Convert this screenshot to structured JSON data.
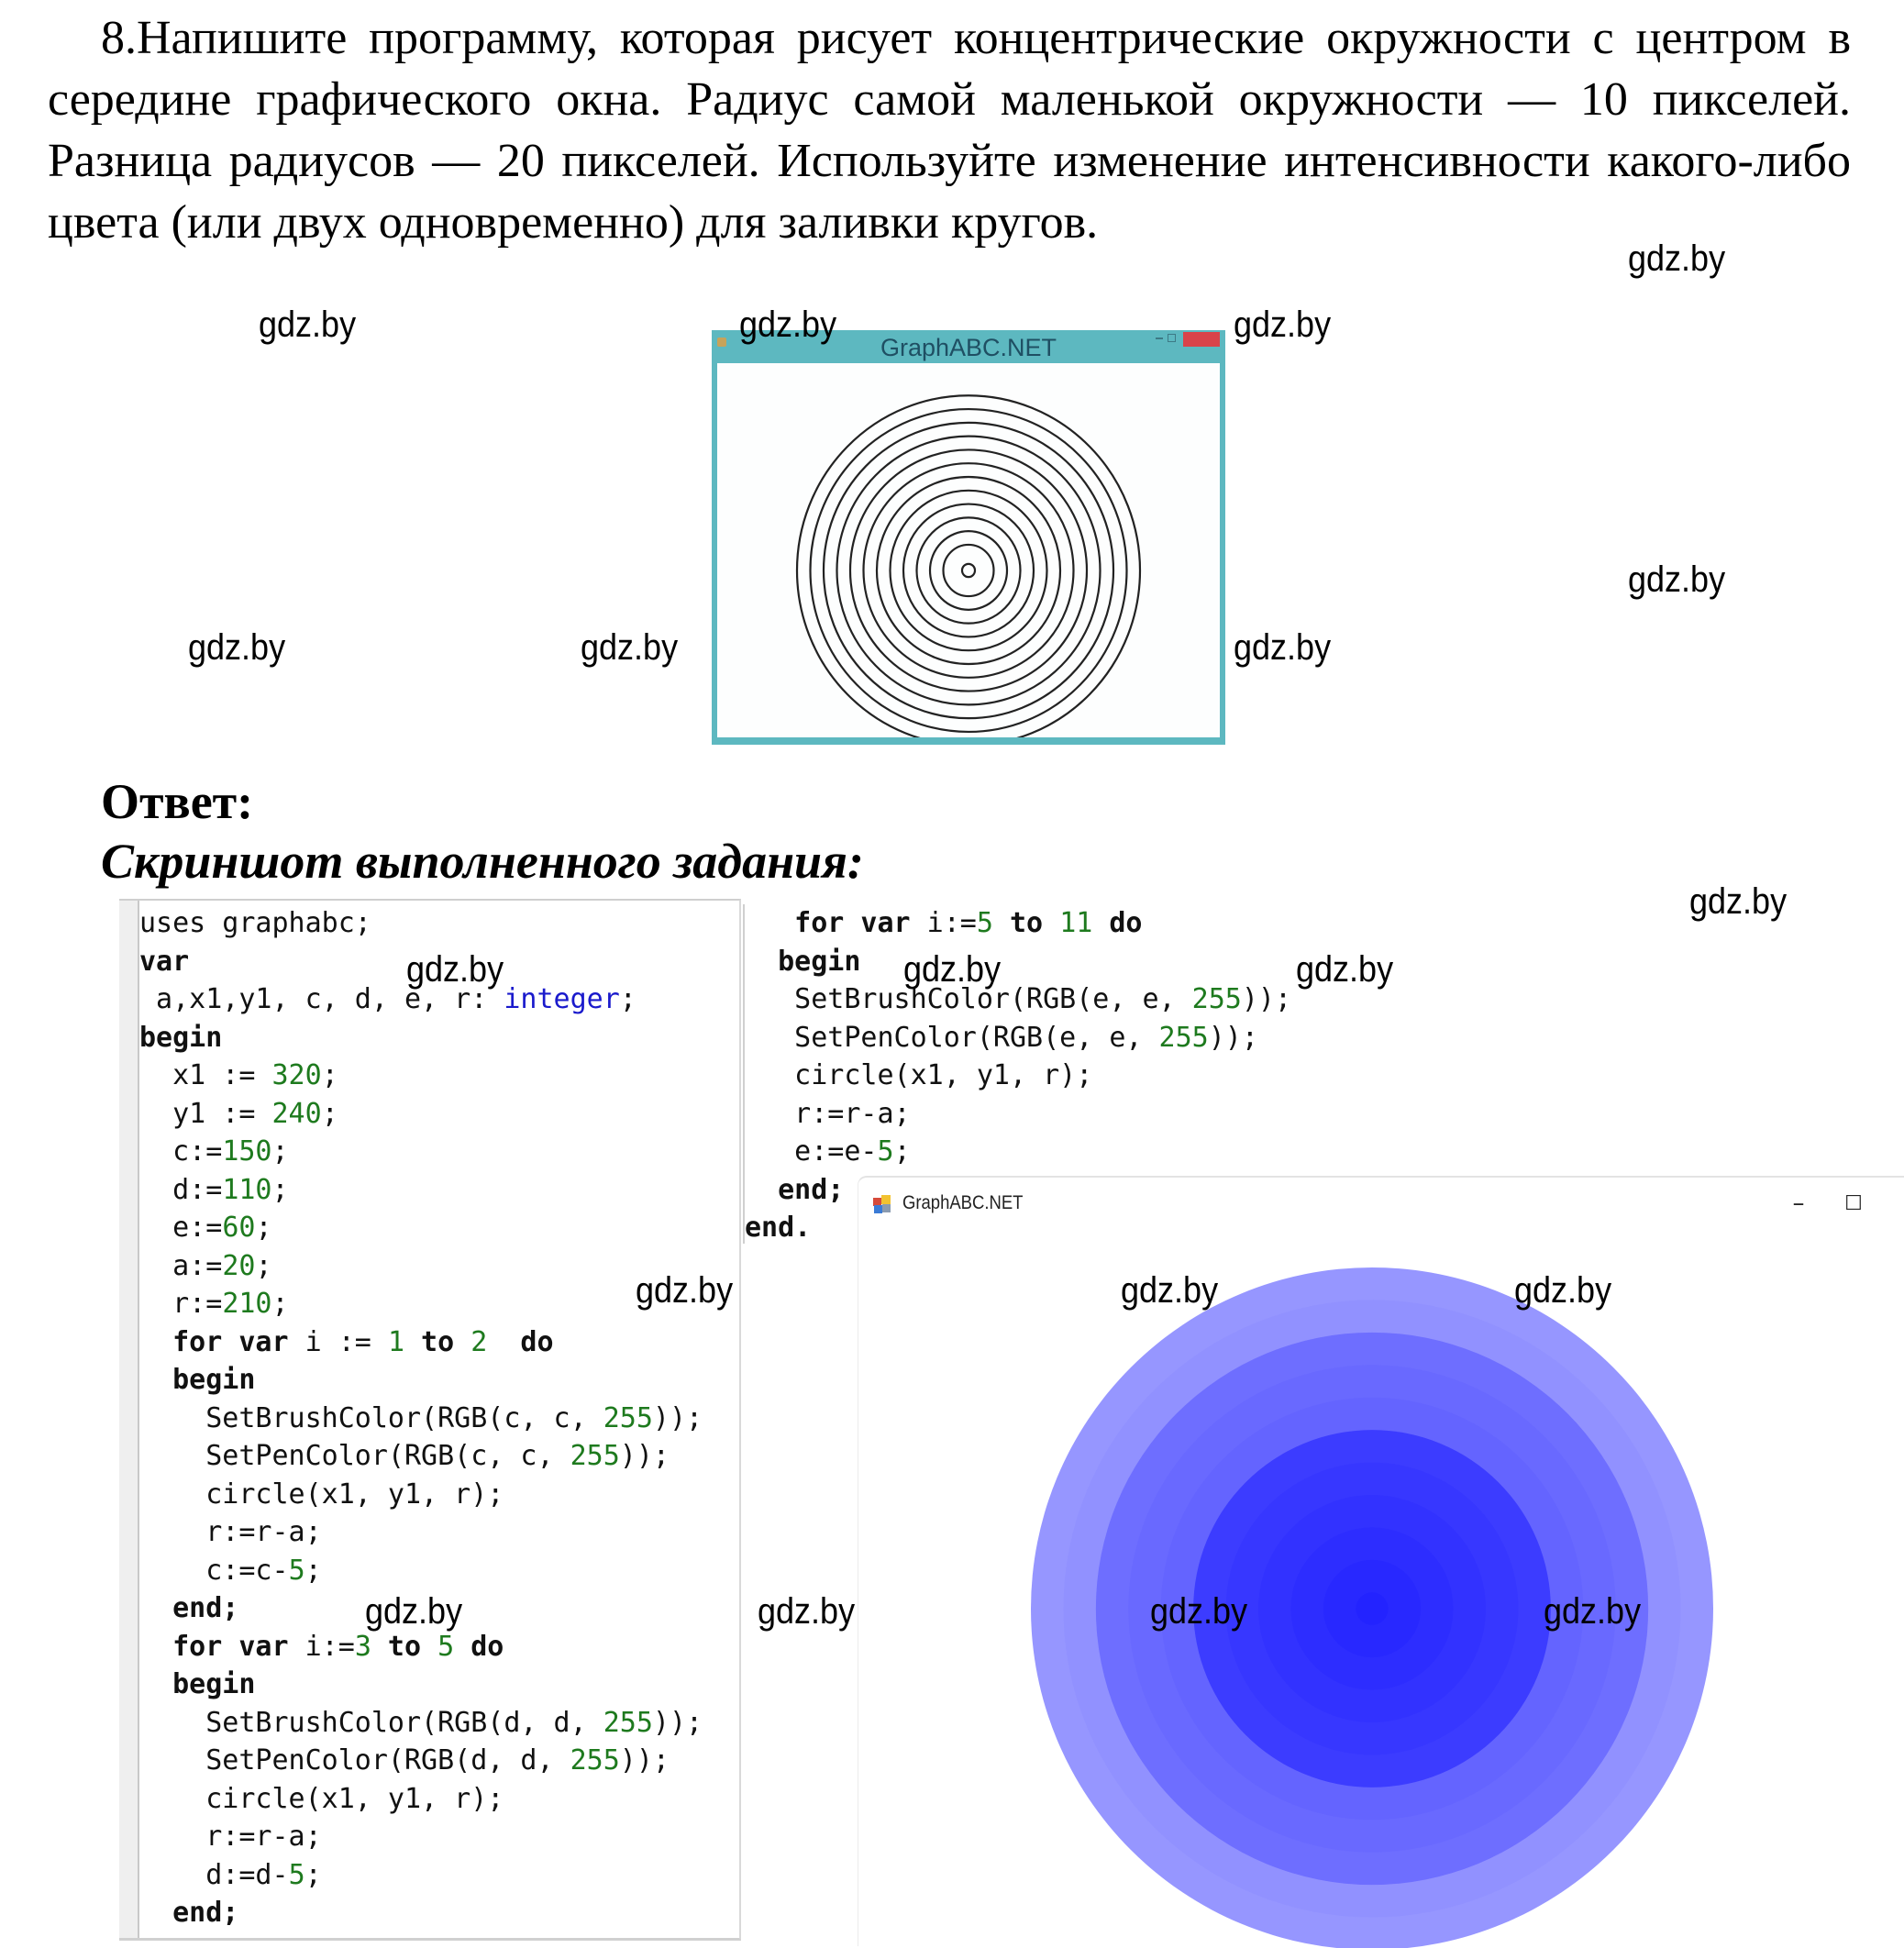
{
  "task": {
    "text": "8.Напишите программу, которая рисует концентрические окружности с центром в середине графического окна. Радиус самой маленькой окружности — 10 пикселей. Разница радиусов — 20 пикселей. Используйте изменение интенсивности какого-либо цвета (или двух одновременно) для заливки кругов."
  },
  "watermark": "gdz.by",
  "example_window": {
    "title": "GraphABC.NET",
    "ring_count": 13,
    "ring_color": "#222222",
    "frame_color": "#5db8c0"
  },
  "answer": {
    "heading": "Ответ:",
    "subtitle": "Скриншот выполненного задания:"
  },
  "code_left": [
    [
      {
        "t": "uses graphabc;",
        "c": "kw-plain"
      }
    ],
    [
      {
        "t": "var",
        "c": "kw"
      }
    ],
    [
      {
        "t": " a,x1,y1, c, d, e, r: "
      },
      {
        "t": "integer",
        "c": "type"
      },
      {
        "t": ";"
      }
    ],
    [
      {
        "t": "begin",
        "c": "kw"
      }
    ],
    [
      {
        "t": "  x1 := "
      },
      {
        "t": "320",
        "c": "num"
      },
      {
        "t": ";"
      }
    ],
    [
      {
        "t": "  y1 := "
      },
      {
        "t": "240",
        "c": "num"
      },
      {
        "t": ";"
      }
    ],
    [
      {
        "t": "  c:="
      },
      {
        "t": "150",
        "c": "num"
      },
      {
        "t": ";"
      }
    ],
    [
      {
        "t": "  d:="
      },
      {
        "t": "110",
        "c": "num"
      },
      {
        "t": ";"
      }
    ],
    [
      {
        "t": "  e:="
      },
      {
        "t": "60",
        "c": "num"
      },
      {
        "t": ";"
      }
    ],
    [
      {
        "t": "  a:="
      },
      {
        "t": "20",
        "c": "num"
      },
      {
        "t": ";"
      }
    ],
    [
      {
        "t": "  r:="
      },
      {
        "t": "210",
        "c": "num"
      },
      {
        "t": ";"
      }
    ],
    [
      {
        "t": "  for var",
        "c": "kw"
      },
      {
        "t": " i := "
      },
      {
        "t": "1",
        "c": "num"
      },
      {
        "t": " to ",
        "c": "kw"
      },
      {
        "t": "2",
        "c": "num"
      },
      {
        "t": "  do",
        "c": "kw"
      }
    ],
    [
      {
        "t": "  begin",
        "c": "kw"
      }
    ],
    [
      {
        "t": "    SetBrushColor(RGB(c, c, "
      },
      {
        "t": "255",
        "c": "num"
      },
      {
        "t": "));"
      }
    ],
    [
      {
        "t": "    SetPenColor(RGB(c, c, "
      },
      {
        "t": "255",
        "c": "num"
      },
      {
        "t": "));"
      }
    ],
    [
      {
        "t": "    circle(x1, y1, r);"
      }
    ],
    [
      {
        "t": "    r:=r-a;"
      }
    ],
    [
      {
        "t": "    c:=c-"
      },
      {
        "t": "5",
        "c": "num"
      },
      {
        "t": ";"
      }
    ],
    [
      {
        "t": "  end;",
        "c": "kw"
      }
    ],
    [
      {
        "t": "  for var",
        "c": "kw"
      },
      {
        "t": " i:="
      },
      {
        "t": "3",
        "c": "num"
      },
      {
        "t": " to ",
        "c": "kw"
      },
      {
        "t": "5",
        "c": "num"
      },
      {
        "t": " do",
        "c": "kw"
      }
    ],
    [
      {
        "t": "  begin",
        "c": "kw"
      }
    ],
    [
      {
        "t": "    SetBrushColor(RGB(d, d, "
      },
      {
        "t": "255",
        "c": "num"
      },
      {
        "t": "));"
      }
    ],
    [
      {
        "t": "    SetPenColor(RGB(d, d, "
      },
      {
        "t": "255",
        "c": "num"
      },
      {
        "t": "));"
      }
    ],
    [
      {
        "t": "    circle(x1, y1, r);"
      }
    ],
    [
      {
        "t": "    r:=r-a;"
      }
    ],
    [
      {
        "t": "    d:=d-"
      },
      {
        "t": "5",
        "c": "num"
      },
      {
        "t": ";"
      }
    ],
    [
      {
        "t": "  end;",
        "c": "kw"
      }
    ]
  ],
  "code_right": [
    [
      {
        "t": "   for var",
        "c": "kw"
      },
      {
        "t": " i:="
      },
      {
        "t": "5",
        "c": "num"
      },
      {
        "t": " to ",
        "c": "kw"
      },
      {
        "t": "11",
        "c": "num"
      },
      {
        "t": " do",
        "c": "kw"
      }
    ],
    [
      {
        "t": "  begin",
        "c": "kw"
      }
    ],
    [
      {
        "t": "   SetBrushColor(RGB(e, e, "
      },
      {
        "t": "255",
        "c": "num"
      },
      {
        "t": "));"
      }
    ],
    [
      {
        "t": "   SetPenColor(RGB(e, e, "
      },
      {
        "t": "255",
        "c": "num"
      },
      {
        "t": "));"
      }
    ],
    [
      {
        "t": "   circle(x1, y1, r);"
      }
    ],
    [
      {
        "t": "   r:=r-a;"
      }
    ],
    [
      {
        "t": "   e:=e-"
      },
      {
        "t": "5",
        "c": "num"
      },
      {
        "t": ";"
      }
    ],
    [
      {
        "t": "  end;",
        "c": "kw"
      }
    ],
    [
      {
        "t": "end.",
        "c": "kw"
      }
    ]
  ],
  "result_window": {
    "title": "GraphABC.NET",
    "minimize_label": "–",
    "maximize_label": "☐",
    "close_label": "✕",
    "circles": [
      {
        "r": 210,
        "rgb": [
          150,
          150,
          255
        ]
      },
      {
        "r": 190,
        "rgb": [
          145,
          145,
          255
        ]
      },
      {
        "r": 170,
        "rgb": [
          110,
          110,
          255
        ]
      },
      {
        "r": 150,
        "rgb": [
          105,
          105,
          255
        ]
      },
      {
        "r": 130,
        "rgb": [
          100,
          100,
          255
        ]
      },
      {
        "r": 110,
        "rgb": [
          60,
          60,
          255
        ]
      },
      {
        "r": 90,
        "rgb": [
          55,
          55,
          255
        ]
      },
      {
        "r": 70,
        "rgb": [
          50,
          50,
          255
        ]
      },
      {
        "r": 50,
        "rgb": [
          45,
          45,
          255
        ]
      },
      {
        "r": 30,
        "rgb": [
          40,
          40,
          255
        ]
      },
      {
        "r": 10,
        "rgb": [
          35,
          35,
          255
        ]
      }
    ]
  }
}
